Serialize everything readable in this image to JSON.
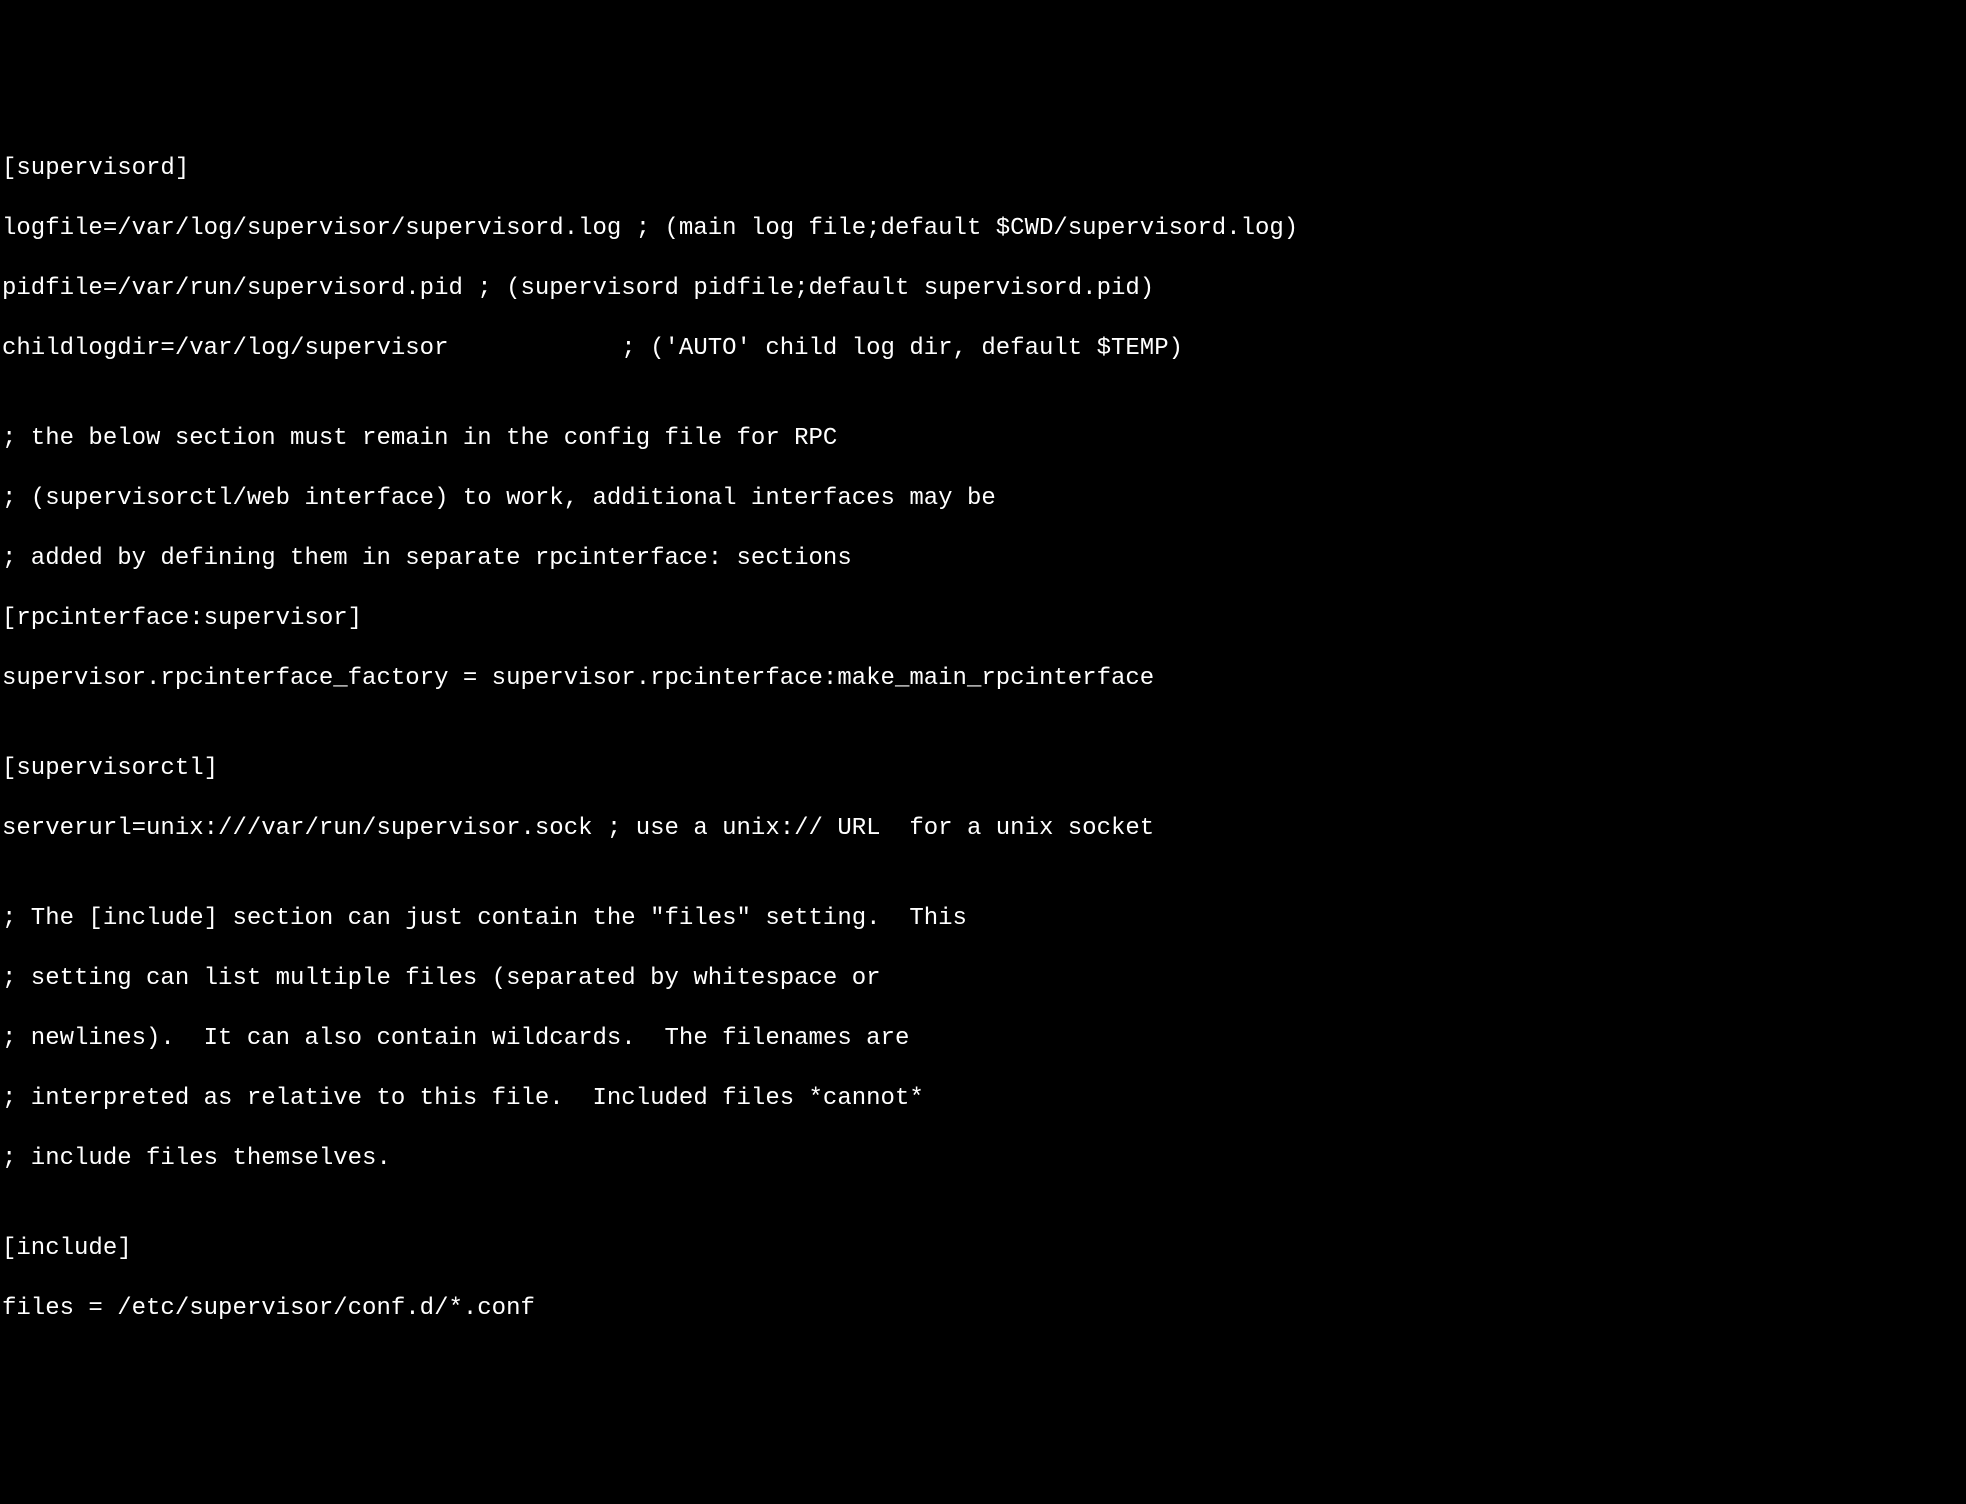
{
  "lines": {
    "l0": "[supervisord]",
    "l1": "logfile=/var/log/supervisor/supervisord.log ; (main log file;default $CWD/supervisord.log)",
    "l2": "pidfile=/var/run/supervisord.pid ; (supervisord pidfile;default supervisord.pid)",
    "l3": "childlogdir=/var/log/supervisor            ; ('AUTO' child log dir, default $TEMP)",
    "l4": "",
    "l5": "; the below section must remain in the config file for RPC",
    "l6": "; (supervisorctl/web interface) to work, additional interfaces may be",
    "l7": "; added by defining them in separate rpcinterface: sections",
    "l8": "[rpcinterface:supervisor]",
    "l9": "supervisor.rpcinterface_factory = supervisor.rpcinterface:make_main_rpcinterface",
    "l10": "",
    "l11": "[supervisorctl]",
    "l12": "serverurl=unix:///var/run/supervisor.sock ; use a unix:// URL  for a unix socket",
    "l13": "",
    "l14": "; The [include] section can just contain the \"files\" setting.  This",
    "l15": "; setting can list multiple files (separated by whitespace or",
    "l16": "; newlines).  It can also contain wildcards.  The filenames are",
    "l17": "; interpreted as relative to this file.  Included files *cannot*",
    "l18": "; include files themselves.",
    "l19": "",
    "l20": "[include]",
    "l21": "files = /etc/supervisor/conf.d/*.conf"
  }
}
